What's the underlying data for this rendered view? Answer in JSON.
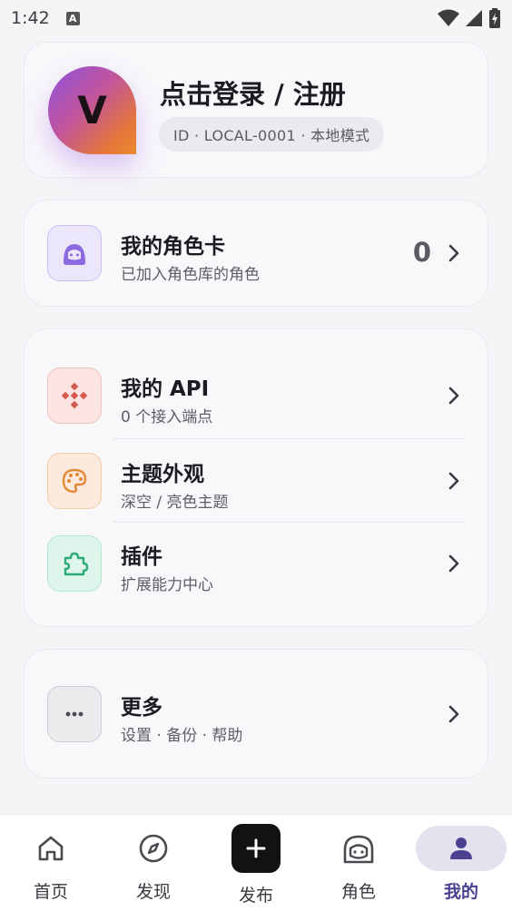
{
  "status_bar": {
    "time": "1:42",
    "badge": "A"
  },
  "profile": {
    "avatar_letter": "V",
    "title": "点击登录 / 注册",
    "id_chip": "ID · LOCAL-0001 · 本地模式"
  },
  "character_cards": {
    "title": "我的角色卡",
    "subtitle": "已加入角色库的角色",
    "count": "0"
  },
  "settings_group": [
    {
      "title": "我的 API",
      "subtitle": "0 个接入端点",
      "icon": "api-icon",
      "color": "#d8584f"
    },
    {
      "title": "主题外观",
      "subtitle": "深空 / 亮色主题",
      "icon": "palette-icon",
      "color": "#e28a3a"
    },
    {
      "title": "插件",
      "subtitle": "扩展能力中心",
      "icon": "puzzle-icon",
      "color": "#2eaa78"
    }
  ],
  "more": {
    "title": "更多",
    "subtitle": "设置 · 备份 · 帮助"
  },
  "bottom_nav": [
    {
      "label": "首页",
      "icon": "home-icon"
    },
    {
      "label": "发现",
      "icon": "compass-icon"
    },
    {
      "label": "发布",
      "icon": "plus-icon"
    },
    {
      "label": "角色",
      "icon": "character-icon"
    },
    {
      "label": "我的",
      "icon": "person-icon",
      "active": true
    }
  ],
  "colors": {
    "accent": "#4a4290",
    "background": "#f5f4f7",
    "card_purple": "#8b6ae0",
    "api_red": "#d8584f",
    "theme_orange": "#e28a3a",
    "plugin_green": "#2eaa78"
  }
}
